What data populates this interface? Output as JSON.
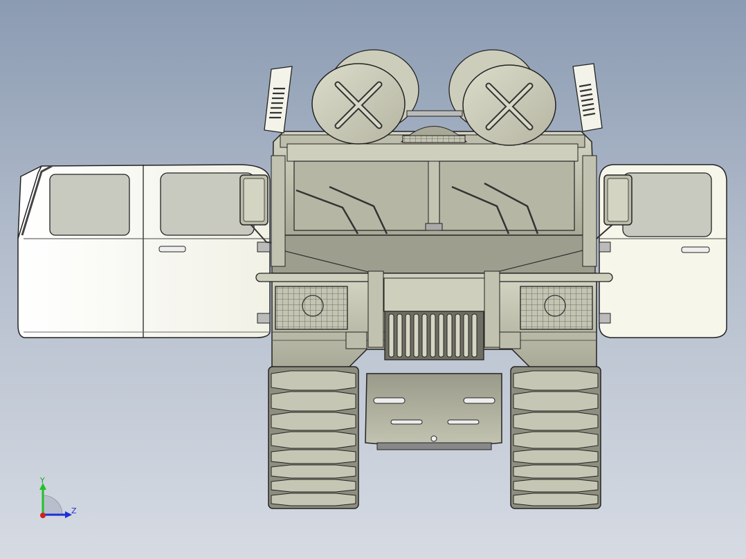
{
  "viewport": {
    "background_top": "#8b9bb2",
    "background_bottom": "#d6dbe3"
  },
  "model": {
    "description_icon": "tracked-vehicle-front-view",
    "body_color": "#c9c9b6",
    "door_color": "#fbfbf5",
    "track_color": "#a8a89a"
  },
  "triad": {
    "y_label": "Y",
    "z_label": "Z",
    "y_color": "#22c02a",
    "z_color": "#1c2fd8",
    "x_color": "#d02020"
  }
}
